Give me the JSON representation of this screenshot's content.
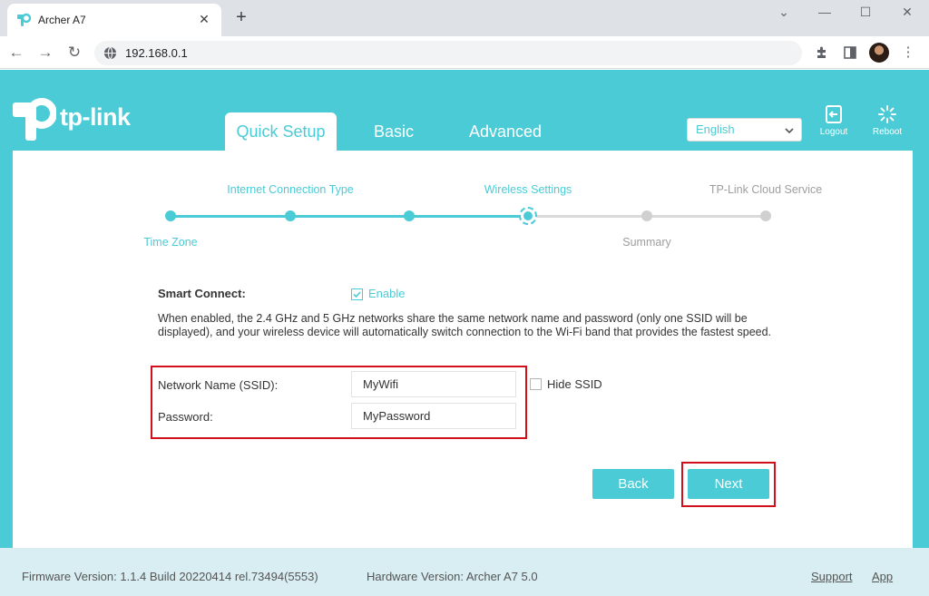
{
  "browser": {
    "tab_title": "Archer A7",
    "url": "192.168.0.1",
    "window_controls": [
      "⌄",
      "—",
      "☐",
      "✕"
    ]
  },
  "header": {
    "logo_text": "tp-link",
    "tabs": [
      {
        "label": "Quick Setup",
        "active": true
      },
      {
        "label": "Basic",
        "active": false
      },
      {
        "label": "Advanced",
        "active": false
      }
    ],
    "language": "English",
    "logout_label": "Logout",
    "reboot_label": "Reboot"
  },
  "stepper": {
    "top_labels": [
      "Internet Connection Type",
      "Wireless Settings",
      "TP-Link Cloud Service"
    ],
    "bottom_labels": [
      "Time Zone",
      "Summary"
    ],
    "current_step": 4,
    "total_steps": 6
  },
  "form": {
    "smart_connect_label": "Smart Connect:",
    "smart_connect_enabled": true,
    "enable_label": "Enable",
    "description": "When enabled, the 2.4 GHz and 5 GHz networks share the same network name and password (only one SSID will be displayed), and your wireless device will automatically switch connection to the Wi-Fi band that provides the fastest speed.",
    "ssid_label": "Network Name (SSID):",
    "ssid_value": "MyWifi",
    "password_label": "Password:",
    "password_value": "MyPassword",
    "hide_ssid_label": "Hide SSID",
    "hide_ssid_checked": false
  },
  "actions": {
    "back_label": "Back",
    "next_label": "Next"
  },
  "footer": {
    "firmware": "Firmware Version: 1.1.4 Build 20220414 rel.73494(5553)",
    "hardware": "Hardware Version: Archer A7 5.0",
    "support_label": "Support",
    "app_label": "App"
  },
  "colors": {
    "brand": "#4acbd6",
    "highlight": "#d0101a"
  }
}
